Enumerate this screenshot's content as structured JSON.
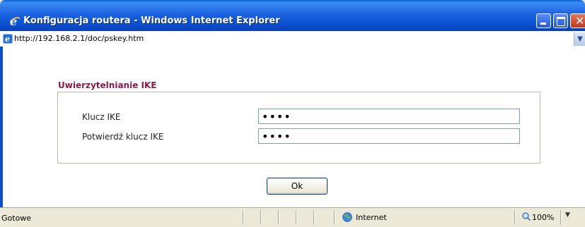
{
  "window": {
    "title": "Konfiguracja routera - Windows Internet Explorer",
    "icon": "internet-explorer-icon"
  },
  "address_bar": {
    "url": "http://192.168.2.1/doc/pskey.htm"
  },
  "form": {
    "section_title": "Uwierzytelnianie IKE",
    "fields": [
      {
        "label": "Klucz IKE",
        "value": "••••"
      },
      {
        "label": "Potwierdź klucz IKE",
        "value": "••••"
      }
    ],
    "ok_label": "Ok"
  },
  "status_bar": {
    "status": "Gotowe",
    "zone": "Internet",
    "zoom": "100%"
  },
  "colors": {
    "titlebar": "#0a4fcf",
    "section_title": "#8b1a4a",
    "input_border": "#7f9db9"
  }
}
